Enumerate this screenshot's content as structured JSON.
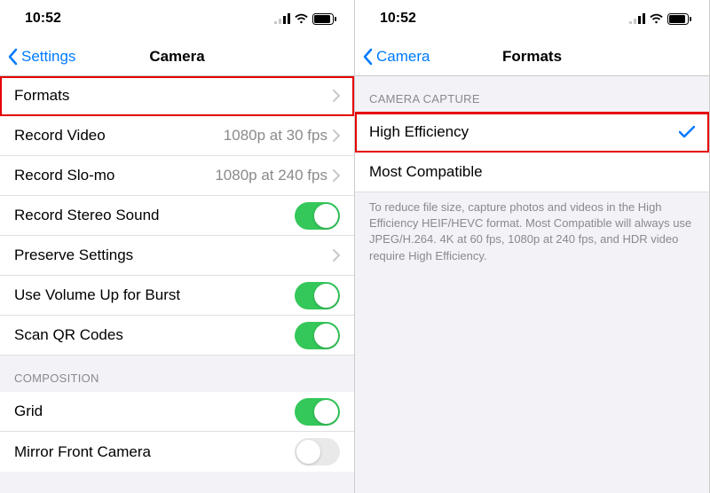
{
  "status": {
    "time": "10:52"
  },
  "left": {
    "back_label": "Settings",
    "title": "Camera",
    "rows": {
      "formats_label": "Formats",
      "record_video_label": "Record Video",
      "record_video_value": "1080p at 30 fps",
      "record_slomo_label": "Record Slo-mo",
      "record_slomo_value": "1080p at 240 fps",
      "stereo_label": "Record Stereo Sound",
      "preserve_label": "Preserve Settings",
      "volume_burst_label": "Use Volume Up for Burst",
      "scan_qr_label": "Scan QR Codes",
      "composition_header": "COMPOSITION",
      "grid_label": "Grid",
      "mirror_label": "Mirror Front Camera"
    }
  },
  "right": {
    "back_label": "Camera",
    "title": "Formats",
    "header": "CAMERA CAPTURE",
    "high_eff": "High Efficiency",
    "most_compat": "Most Compatible",
    "footer": "To reduce file size, capture photos and videos in the High Efficiency HEIF/HEVC format. Most Compatible will always use JPEG/H.264. 4K at 60 fps, 1080p at 240 fps, and HDR video require High Efficiency."
  }
}
